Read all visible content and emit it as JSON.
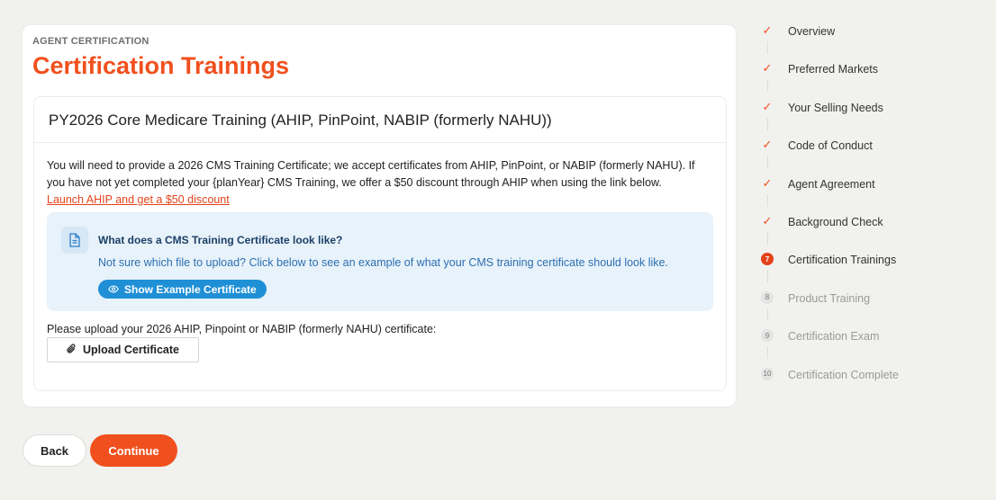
{
  "header": {
    "eyebrow": "AGENT CERTIFICATION",
    "title": "Certification Trainings"
  },
  "training": {
    "heading": "PY2026 Core Medicare Training (AHIP, PinPoint, NABIP (formerly NAHU))",
    "description": "You will need to provide a 2026 CMS Training Certificate; we accept certificates from AHIP, PinPoint, or NABIP (formerly NAHU). If you have not yet completed your {planYear} CMS Training, we offer a $50 discount through AHIP when using the link below.",
    "link_label": "Launch AHIP and get a $50 discount"
  },
  "info_box": {
    "icon": "document-icon",
    "title": "What does a CMS Training Certificate look like?",
    "text": "Not sure which file to upload? Click below to see an example of what your CMS training certificate should look like.",
    "button_label": "Show Example Certificate",
    "button_icon": "eye-icon"
  },
  "upload": {
    "label": "Please upload your 2026 AHIP, Pinpoint or NABIP (formerly NAHU) certificate:",
    "button_label": "Upload Certificate",
    "button_icon": "paperclip-icon"
  },
  "actions": {
    "back_label": "Back",
    "continue_label": "Continue"
  },
  "steps": [
    {
      "label": "Overview",
      "status": "done"
    },
    {
      "label": "Preferred Markets",
      "status": "done"
    },
    {
      "label": "Your Selling Needs",
      "status": "done"
    },
    {
      "label": "Code of Conduct",
      "status": "done"
    },
    {
      "label": "Agent Agreement",
      "status": "done"
    },
    {
      "label": "Background Check",
      "status": "done"
    },
    {
      "label": "Certification Trainings",
      "status": "current",
      "number": "7"
    },
    {
      "label": "Product Training",
      "status": "future",
      "number": "8"
    },
    {
      "label": "Certification Exam",
      "status": "future",
      "number": "9"
    },
    {
      "label": "Certification Complete",
      "status": "future",
      "number": "10"
    }
  ],
  "colors": {
    "accent": "#f0501e",
    "info_bg": "#e8f2fa",
    "info_button": "#1f8fd6",
    "background": "#f1f1ee"
  }
}
